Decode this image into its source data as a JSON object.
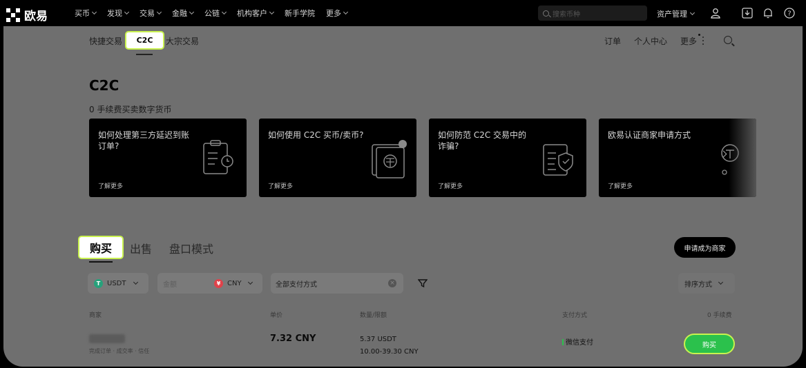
{
  "brand": {
    "name": "欧易"
  },
  "topnav": {
    "menu": [
      "买币",
      "发现",
      "交易",
      "金融",
      "公链",
      "机构客户",
      "新手学院",
      "更多"
    ],
    "menu_dropdown": [
      true,
      true,
      true,
      true,
      true,
      true,
      false,
      true
    ],
    "search_placeholder": "搜索币种",
    "asset_mgmt": "资产管理"
  },
  "subnav": {
    "quick": "快捷交易",
    "c2c": "C2C",
    "bulk": "大宗交易",
    "orders": "订单",
    "personal": "个人中心",
    "more": "更多"
  },
  "hero": {
    "title": "C2C",
    "subtitle": "0 手续费买卖数字货币"
  },
  "cards": [
    {
      "title": "如何处理第三方延迟到账订单?",
      "more": "了解更多",
      "icon": "clipboard-clock-icon"
    },
    {
      "title": "如何使用 C2C 买币/卖币?",
      "more": "了解更多",
      "icon": "tether-card-icon"
    },
    {
      "title": "如何防范 C2C 交易中的诈骗?",
      "more": "了解更多",
      "icon": "shield-document-icon"
    },
    {
      "title": "欧易认证商家申请方式",
      "more": "了解更多",
      "icon": "merchant-badge-icon"
    }
  ],
  "trade_tabs": {
    "buy": "购买",
    "sell": "出售",
    "orderbook": "盘口模式"
  },
  "merchant_button": "申请成为商家",
  "filters": {
    "coin": "USDT",
    "amount_placeholder": "金额",
    "fiat": "CNY",
    "payment": "全部支付方式",
    "sort": "排序方式"
  },
  "table": {
    "headers": [
      "商家",
      "单价",
      "数量/限额",
      "支付方式",
      "0 手续费"
    ],
    "rows": [
      {
        "merchant_meta": "完成订单 · 成交率 · 信任",
        "price": "7.32 CNY",
        "quantity": "5.37 USDT",
        "limit": "10.00-39.30 CNY",
        "payment": "微信支付",
        "action": "购买"
      }
    ]
  },
  "colors": {
    "accent": "#c9f24f",
    "buy_green": "#2bc14c",
    "usdt_green": "#26a17b",
    "cny_red": "#e0424a"
  }
}
